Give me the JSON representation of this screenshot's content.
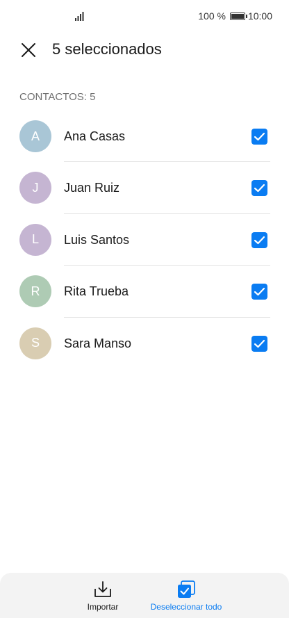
{
  "status_bar": {
    "battery_text": "100 %",
    "time": "10:00"
  },
  "header": {
    "title": "5 seleccionados"
  },
  "section": {
    "label": "CONTACTOS: 5"
  },
  "contacts": [
    {
      "initial": "A",
      "name": "Ana Casas",
      "avatar_color": "#a9c6d6",
      "checked": true
    },
    {
      "initial": "J",
      "name": "Juan Ruiz",
      "avatar_color": "#c5b5d2",
      "checked": true
    },
    {
      "initial": "L",
      "name": "Luis Santos",
      "avatar_color": "#c5b5d2",
      "checked": true
    },
    {
      "initial": "R",
      "name": "Rita Trueba",
      "avatar_color": "#aecbb4",
      "checked": true
    },
    {
      "initial": "S",
      "name": "Sara Manso",
      "avatar_color": "#d9cdb2",
      "checked": true
    }
  ],
  "bottom_bar": {
    "import_label": "Importar",
    "deselect_label": "Deseleccionar todo"
  },
  "colors": {
    "accent": "#0a7cf2",
    "text_primary": "#1a1a1a",
    "text_secondary": "#707070"
  },
  "icons": {
    "close": "close-icon",
    "import": "download-tray-icon",
    "deselect_all": "select-all-icon",
    "checkbox": "checkmark-icon"
  }
}
